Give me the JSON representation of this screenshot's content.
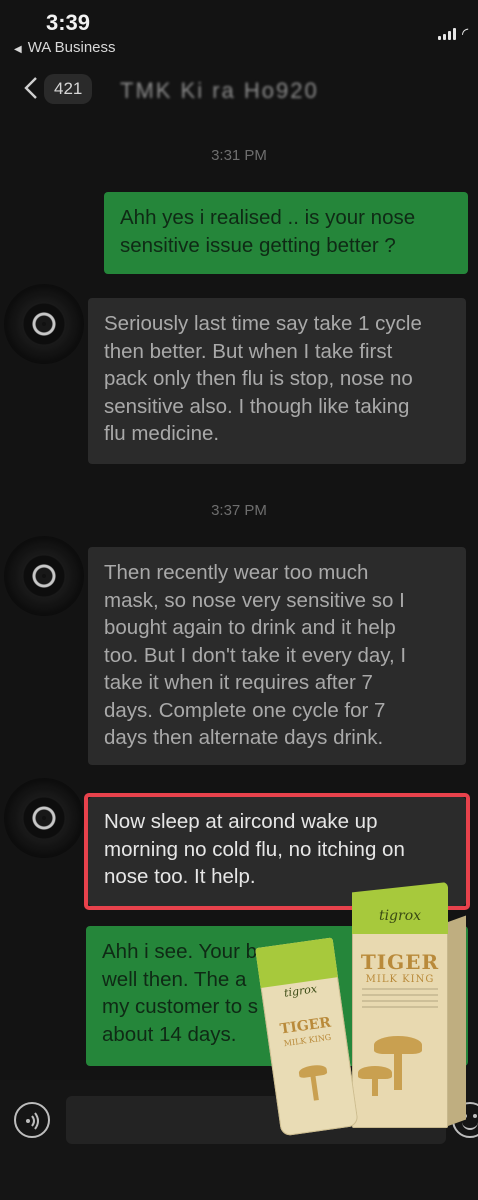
{
  "status_bar": {
    "time": "3:39",
    "back_app": "WA Business"
  },
  "header": {
    "unread_count": "421",
    "contact_name": "TMK Ki        ra Ho920"
  },
  "messages": [
    {
      "type": "timestamp",
      "text": "3:31 PM"
    },
    {
      "type": "outgoing",
      "lines": [
        "Ahh yes i realised .. is your nose",
        "sensitive issue getting better ?"
      ]
    },
    {
      "type": "incoming",
      "lines": [
        "Seriously last time say take 1 cycle",
        "then better. But when I take first",
        "pack only then flu is stop, nose no",
        "sensitive also. I though like taking",
        "flu medicine."
      ]
    },
    {
      "type": "timestamp",
      "text": "3:37 PM"
    },
    {
      "type": "incoming",
      "lines": [
        "Then recently wear too much",
        "mask, so nose very sensitive so I",
        "bought again to drink and it help",
        "too. But I don't take it every day, I",
        "take it when it requires after 7",
        "days. Complete one cycle for 7",
        "days then alternate days drink."
      ]
    },
    {
      "type": "incoming",
      "highlighted": true,
      "lines": [
        "Now sleep at aircond wake up",
        "morning no cold flu, no itching on",
        "nose too. It help."
      ]
    },
    {
      "type": "outgoing",
      "lines": [
        "Ahh i see. Your b      abs",
        "well then. The a",
        "my customer to s",
        "about 14 days."
      ]
    }
  ],
  "input": {
    "value": "",
    "placeholder": ""
  },
  "product": {
    "brand": "tigrox",
    "title": "TIGER",
    "subtitle": "MILK KING"
  },
  "colors": {
    "outgoing_bubble": "#25863a",
    "incoming_bubble": "#2b2b2b",
    "highlight": "#e8424c",
    "brand_green": "#a7c93c"
  },
  "icons": [
    "back-arrow-icon",
    "signal-icon",
    "wifi-icon",
    "voice-icon",
    "emoji-icon",
    "avatar-vinyl-icon"
  ]
}
